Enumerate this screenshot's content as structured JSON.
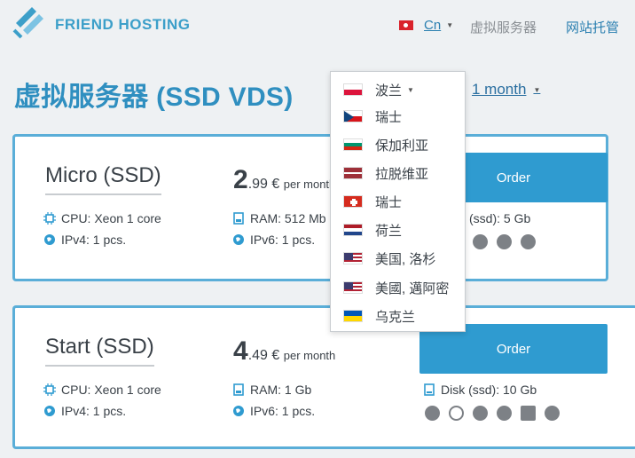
{
  "header": {
    "brand": "FRIEND HOSTING",
    "lang_label": "Cn",
    "nav": [
      "虚拟服务器",
      "网站托管"
    ]
  },
  "page": {
    "title": "虚拟服务器 (SSD VDS)",
    "period_label": "1 month"
  },
  "dropdown": {
    "items": [
      {
        "label": "波兰",
        "flag": "pl"
      },
      {
        "label": "瑞士",
        "flag": "cz"
      },
      {
        "label": "保加利亚",
        "flag": "bg"
      },
      {
        "label": "拉脱维亚",
        "flag": "lv"
      },
      {
        "label": "瑞士",
        "flag": "ch"
      },
      {
        "label": "荷兰",
        "flag": "nl"
      },
      {
        "label": "美国, 洛杉",
        "flag": "us"
      },
      {
        "label": "美國, 邁阿密",
        "flag": "us"
      },
      {
        "label": "乌克兰",
        "flag": "ua"
      }
    ]
  },
  "plans": [
    {
      "name": "Micro (SSD)",
      "price_int": "2",
      "price_dec": ".99 €",
      "price_unit": "per month",
      "order_label": "Order",
      "cpu": "CPU: Xeon 1 core",
      "ipv4": "IPv4: 1 pcs.",
      "ram": "RAM: 512 Mb",
      "ipv6": "IPv6: 1 pcs.",
      "disk": "(ssd): 5 Gb"
    },
    {
      "name": "Start (SSD)",
      "price_int": "4",
      "price_dec": ".49 €",
      "price_unit": "per month",
      "order_label": "Order",
      "cpu": "CPU: Xeon 1 core",
      "ipv4": "IPv4: 1 pcs.",
      "ram": "RAM: 1 Gb",
      "ipv6": "IPv6: 1 pcs.",
      "disk": "Disk (ssd): 10 Gb"
    }
  ],
  "colors": {
    "accent": "#2f9bd0",
    "brand": "#3c9fc9",
    "title": "#2f8fc0"
  }
}
